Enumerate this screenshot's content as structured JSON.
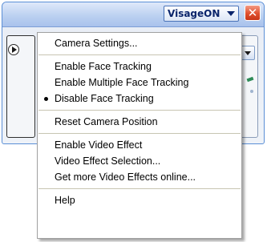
{
  "window": {
    "brand_label": "VisageON",
    "close_symbol": "✕"
  },
  "menu": {
    "groups": [
      {
        "items": [
          {
            "label": "Camera Settings..."
          }
        ]
      },
      {
        "items": [
          {
            "label": "Enable Face Tracking"
          },
          {
            "label": "Enable Multiple Face Tracking"
          },
          {
            "label": "Disable Face Tracking",
            "selected": true
          }
        ]
      },
      {
        "items": [
          {
            "label": "Reset Camera Position"
          }
        ]
      },
      {
        "items": [
          {
            "label": "Enable Video Effect"
          },
          {
            "label": "Video Effect Selection..."
          },
          {
            "label": "Get more Video Effects online..."
          }
        ]
      },
      {
        "items": [
          {
            "label": "Help"
          }
        ]
      }
    ]
  },
  "colors": {
    "titlebar": "#b9cff0",
    "brand_text": "#0a246a",
    "close_button": "#e0502e",
    "menu_background": "#ffffff",
    "separator": "#c7c5b2"
  }
}
